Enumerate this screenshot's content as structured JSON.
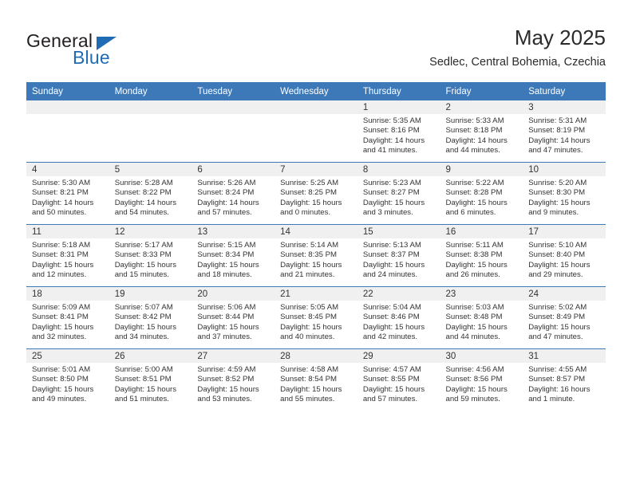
{
  "brand": {
    "name_part1": "General",
    "name_part2": "Blue",
    "accent_color": "#1f6cb4"
  },
  "header": {
    "title": "May 2025",
    "subtitle": "Sedlec, Central Bohemia, Czechia"
  },
  "calendar": {
    "header_bg": "#3d79b8",
    "daynum_bg": "#f0f0f0",
    "weekday_headers": [
      "Sunday",
      "Monday",
      "Tuesday",
      "Wednesday",
      "Thursday",
      "Friday",
      "Saturday"
    ],
    "weeks": [
      [
        {
          "day": "",
          "sunrise": "",
          "sunset": "",
          "daylight_line1": "",
          "daylight_line2": ""
        },
        {
          "day": "",
          "sunrise": "",
          "sunset": "",
          "daylight_line1": "",
          "daylight_line2": ""
        },
        {
          "day": "",
          "sunrise": "",
          "sunset": "",
          "daylight_line1": "",
          "daylight_line2": ""
        },
        {
          "day": "",
          "sunrise": "",
          "sunset": "",
          "daylight_line1": "",
          "daylight_line2": ""
        },
        {
          "day": "1",
          "sunrise": "Sunrise: 5:35 AM",
          "sunset": "Sunset: 8:16 PM",
          "daylight_line1": "Daylight: 14 hours",
          "daylight_line2": "and 41 minutes."
        },
        {
          "day": "2",
          "sunrise": "Sunrise: 5:33 AM",
          "sunset": "Sunset: 8:18 PM",
          "daylight_line1": "Daylight: 14 hours",
          "daylight_line2": "and 44 minutes."
        },
        {
          "day": "3",
          "sunrise": "Sunrise: 5:31 AM",
          "sunset": "Sunset: 8:19 PM",
          "daylight_line1": "Daylight: 14 hours",
          "daylight_line2": "and 47 minutes."
        }
      ],
      [
        {
          "day": "4",
          "sunrise": "Sunrise: 5:30 AM",
          "sunset": "Sunset: 8:21 PM",
          "daylight_line1": "Daylight: 14 hours",
          "daylight_line2": "and 50 minutes."
        },
        {
          "day": "5",
          "sunrise": "Sunrise: 5:28 AM",
          "sunset": "Sunset: 8:22 PM",
          "daylight_line1": "Daylight: 14 hours",
          "daylight_line2": "and 54 minutes."
        },
        {
          "day": "6",
          "sunrise": "Sunrise: 5:26 AM",
          "sunset": "Sunset: 8:24 PM",
          "daylight_line1": "Daylight: 14 hours",
          "daylight_line2": "and 57 minutes."
        },
        {
          "day": "7",
          "sunrise": "Sunrise: 5:25 AM",
          "sunset": "Sunset: 8:25 PM",
          "daylight_line1": "Daylight: 15 hours",
          "daylight_line2": "and 0 minutes."
        },
        {
          "day": "8",
          "sunrise": "Sunrise: 5:23 AM",
          "sunset": "Sunset: 8:27 PM",
          "daylight_line1": "Daylight: 15 hours",
          "daylight_line2": "and 3 minutes."
        },
        {
          "day": "9",
          "sunrise": "Sunrise: 5:22 AM",
          "sunset": "Sunset: 8:28 PM",
          "daylight_line1": "Daylight: 15 hours",
          "daylight_line2": "and 6 minutes."
        },
        {
          "day": "10",
          "sunrise": "Sunrise: 5:20 AM",
          "sunset": "Sunset: 8:30 PM",
          "daylight_line1": "Daylight: 15 hours",
          "daylight_line2": "and 9 minutes."
        }
      ],
      [
        {
          "day": "11",
          "sunrise": "Sunrise: 5:18 AM",
          "sunset": "Sunset: 8:31 PM",
          "daylight_line1": "Daylight: 15 hours",
          "daylight_line2": "and 12 minutes."
        },
        {
          "day": "12",
          "sunrise": "Sunrise: 5:17 AM",
          "sunset": "Sunset: 8:33 PM",
          "daylight_line1": "Daylight: 15 hours",
          "daylight_line2": "and 15 minutes."
        },
        {
          "day": "13",
          "sunrise": "Sunrise: 5:15 AM",
          "sunset": "Sunset: 8:34 PM",
          "daylight_line1": "Daylight: 15 hours",
          "daylight_line2": "and 18 minutes."
        },
        {
          "day": "14",
          "sunrise": "Sunrise: 5:14 AM",
          "sunset": "Sunset: 8:35 PM",
          "daylight_line1": "Daylight: 15 hours",
          "daylight_line2": "and 21 minutes."
        },
        {
          "day": "15",
          "sunrise": "Sunrise: 5:13 AM",
          "sunset": "Sunset: 8:37 PM",
          "daylight_line1": "Daylight: 15 hours",
          "daylight_line2": "and 24 minutes."
        },
        {
          "day": "16",
          "sunrise": "Sunrise: 5:11 AM",
          "sunset": "Sunset: 8:38 PM",
          "daylight_line1": "Daylight: 15 hours",
          "daylight_line2": "and 26 minutes."
        },
        {
          "day": "17",
          "sunrise": "Sunrise: 5:10 AM",
          "sunset": "Sunset: 8:40 PM",
          "daylight_line1": "Daylight: 15 hours",
          "daylight_line2": "and 29 minutes."
        }
      ],
      [
        {
          "day": "18",
          "sunrise": "Sunrise: 5:09 AM",
          "sunset": "Sunset: 8:41 PM",
          "daylight_line1": "Daylight: 15 hours",
          "daylight_line2": "and 32 minutes."
        },
        {
          "day": "19",
          "sunrise": "Sunrise: 5:07 AM",
          "sunset": "Sunset: 8:42 PM",
          "daylight_line1": "Daylight: 15 hours",
          "daylight_line2": "and 34 minutes."
        },
        {
          "day": "20",
          "sunrise": "Sunrise: 5:06 AM",
          "sunset": "Sunset: 8:44 PM",
          "daylight_line1": "Daylight: 15 hours",
          "daylight_line2": "and 37 minutes."
        },
        {
          "day": "21",
          "sunrise": "Sunrise: 5:05 AM",
          "sunset": "Sunset: 8:45 PM",
          "daylight_line1": "Daylight: 15 hours",
          "daylight_line2": "and 40 minutes."
        },
        {
          "day": "22",
          "sunrise": "Sunrise: 5:04 AM",
          "sunset": "Sunset: 8:46 PM",
          "daylight_line1": "Daylight: 15 hours",
          "daylight_line2": "and 42 minutes."
        },
        {
          "day": "23",
          "sunrise": "Sunrise: 5:03 AM",
          "sunset": "Sunset: 8:48 PM",
          "daylight_line1": "Daylight: 15 hours",
          "daylight_line2": "and 44 minutes."
        },
        {
          "day": "24",
          "sunrise": "Sunrise: 5:02 AM",
          "sunset": "Sunset: 8:49 PM",
          "daylight_line1": "Daylight: 15 hours",
          "daylight_line2": "and 47 minutes."
        }
      ],
      [
        {
          "day": "25",
          "sunrise": "Sunrise: 5:01 AM",
          "sunset": "Sunset: 8:50 PM",
          "daylight_line1": "Daylight: 15 hours",
          "daylight_line2": "and 49 minutes."
        },
        {
          "day": "26",
          "sunrise": "Sunrise: 5:00 AM",
          "sunset": "Sunset: 8:51 PM",
          "daylight_line1": "Daylight: 15 hours",
          "daylight_line2": "and 51 minutes."
        },
        {
          "day": "27",
          "sunrise": "Sunrise: 4:59 AM",
          "sunset": "Sunset: 8:52 PM",
          "daylight_line1": "Daylight: 15 hours",
          "daylight_line2": "and 53 minutes."
        },
        {
          "day": "28",
          "sunrise": "Sunrise: 4:58 AM",
          "sunset": "Sunset: 8:54 PM",
          "daylight_line1": "Daylight: 15 hours",
          "daylight_line2": "and 55 minutes."
        },
        {
          "day": "29",
          "sunrise": "Sunrise: 4:57 AM",
          "sunset": "Sunset: 8:55 PM",
          "daylight_line1": "Daylight: 15 hours",
          "daylight_line2": "and 57 minutes."
        },
        {
          "day": "30",
          "sunrise": "Sunrise: 4:56 AM",
          "sunset": "Sunset: 8:56 PM",
          "daylight_line1": "Daylight: 15 hours",
          "daylight_line2": "and 59 minutes."
        },
        {
          "day": "31",
          "sunrise": "Sunrise: 4:55 AM",
          "sunset": "Sunset: 8:57 PM",
          "daylight_line1": "Daylight: 16 hours",
          "daylight_line2": "and 1 minute."
        }
      ]
    ]
  }
}
